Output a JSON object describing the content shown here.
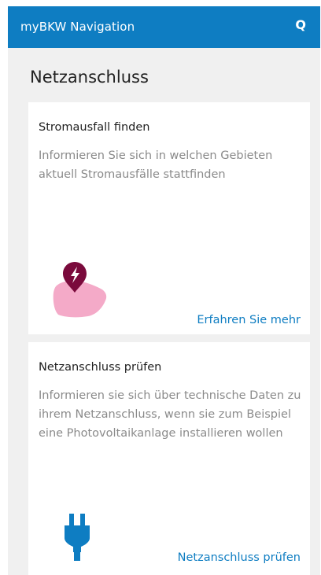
{
  "appbar": {
    "title": "myBKW Navigation",
    "action_label": "Q"
  },
  "page": {
    "title": "Netzanschluss"
  },
  "cards": [
    {
      "title": "Stromausfall finden",
      "description": "Informieren Sie sich in welchen Gebieten aktuell Stromausfälle stattfinden",
      "link": "Erfahren Sie mehr",
      "icon": "power-outage-map-icon"
    },
    {
      "title": "Netzanschluss prüfen",
      "description": "Informieren sie sich über technische Daten zu ihrem Netzanschluss, wenn sie zum Beispiel eine Photovoltaikanlage installieren wollen",
      "link": "Netzanschluss prüfen",
      "icon": "power-plug-icon"
    }
  ],
  "colors": {
    "brand": "#0e7dc2",
    "background": "#f0f0f0",
    "card": "#ffffff",
    "marker": "#7a0a3c",
    "map_area": "#f4aac8"
  }
}
